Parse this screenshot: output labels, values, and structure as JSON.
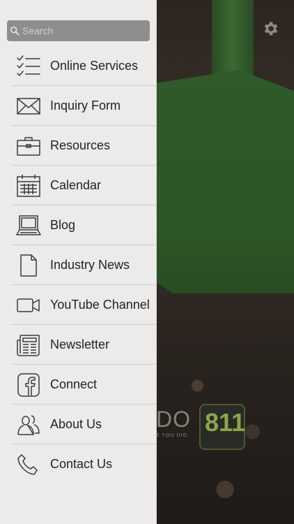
{
  "search": {
    "placeholder": "Search",
    "value": ""
  },
  "menu": {
    "items": [
      {
        "label": "Online Services",
        "icon": "checklist-icon"
      },
      {
        "label": "Inquiry Form",
        "icon": "envelope-icon"
      },
      {
        "label": "Resources",
        "icon": "briefcase-icon"
      },
      {
        "label": "Calendar",
        "icon": "calendar-icon"
      },
      {
        "label": "Blog",
        "icon": "laptop-icon"
      },
      {
        "label": "Industry News",
        "icon": "document-icon"
      },
      {
        "label": "YouTube Channel",
        "icon": "video-camera-icon"
      },
      {
        "label": "Newsletter",
        "icon": "newspaper-icon"
      },
      {
        "label": "Connect",
        "icon": "facebook-icon"
      },
      {
        "label": "About Us",
        "icon": "people-icon"
      },
      {
        "label": "Contact Us",
        "icon": "phone-icon"
      }
    ]
  },
  "background": {
    "logo_text": "DO",
    "logo_number": "811",
    "logo_tagline": "E YOU DIG."
  },
  "colors": {
    "drawer_bg": "#ecebea",
    "search_bg": "#8e8e8e",
    "text": "#232323",
    "icon": "#3a3a3a"
  }
}
